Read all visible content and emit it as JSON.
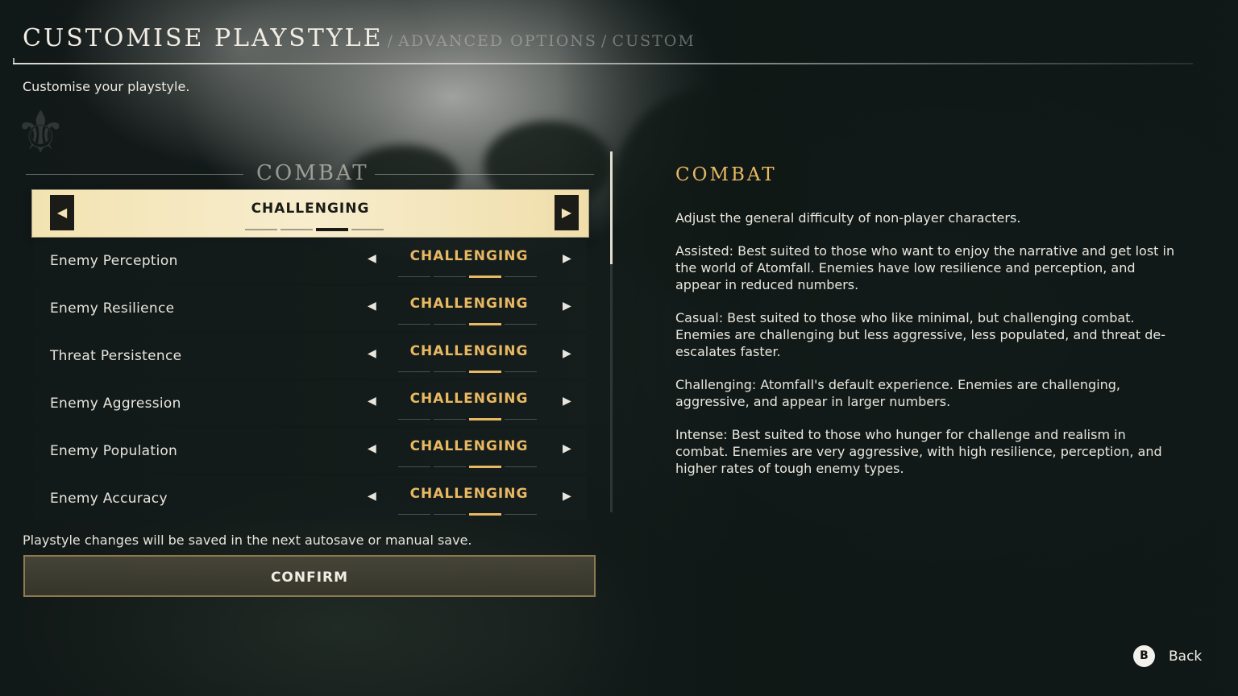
{
  "header": {
    "title": "CUSTOMISE PLAYSTYLE",
    "separator": "/",
    "crumbs": [
      "ADVANCED OPTIONS",
      "CUSTOM"
    ],
    "subtitle": "Customise your playstyle."
  },
  "section": {
    "title": "COMBAT",
    "preset_value": "CHALLENGING",
    "preset_level": 3,
    "pip_count": 4,
    "left_glyph": "◀",
    "right_glyph": "▶"
  },
  "settings": [
    {
      "label": "Enemy Perception",
      "value": "CHALLENGING",
      "level": 3
    },
    {
      "label": "Enemy Resilience",
      "value": "CHALLENGING",
      "level": 3
    },
    {
      "label": "Threat Persistence",
      "value": "CHALLENGING",
      "level": 3
    },
    {
      "label": "Enemy Aggression",
      "value": "CHALLENGING",
      "level": 3
    },
    {
      "label": "Enemy Population",
      "value": "CHALLENGING",
      "level": 3
    },
    {
      "label": "Enemy Accuracy",
      "value": "CHALLENGING",
      "level": 3
    }
  ],
  "footer": {
    "save_note": "Playstyle changes will be saved in the next autosave or manual save.",
    "confirm_label": "CONFIRM"
  },
  "info": {
    "title": "COMBAT",
    "paragraphs": [
      "Adjust the general difficulty of non-player characters.",
      "Assisted: Best suited to those who want to enjoy the narrative and get lost in the world of Atomfall. Enemies have low resilience and perception, and appear in reduced numbers.",
      "Casual: Best suited to those who like minimal, but challenging combat. Enemies are challenging but less aggressive, less populated, and threat de-escalates faster.",
      "Challenging: Atomfall's default experience. Enemies are challenging, aggressive, and appear in larger numbers.",
      "Intense: Best suited to those who hunger for challenge and realism in combat. Enemies are very aggressive, with high resilience, perception, and higher rates of tough enemy types."
    ]
  },
  "back": {
    "button_glyph": "B",
    "label": "Back"
  },
  "colors": {
    "accent": "#e9b862",
    "highlight": "#f3e3b2",
    "confirm_border": "#8d7a4f"
  }
}
